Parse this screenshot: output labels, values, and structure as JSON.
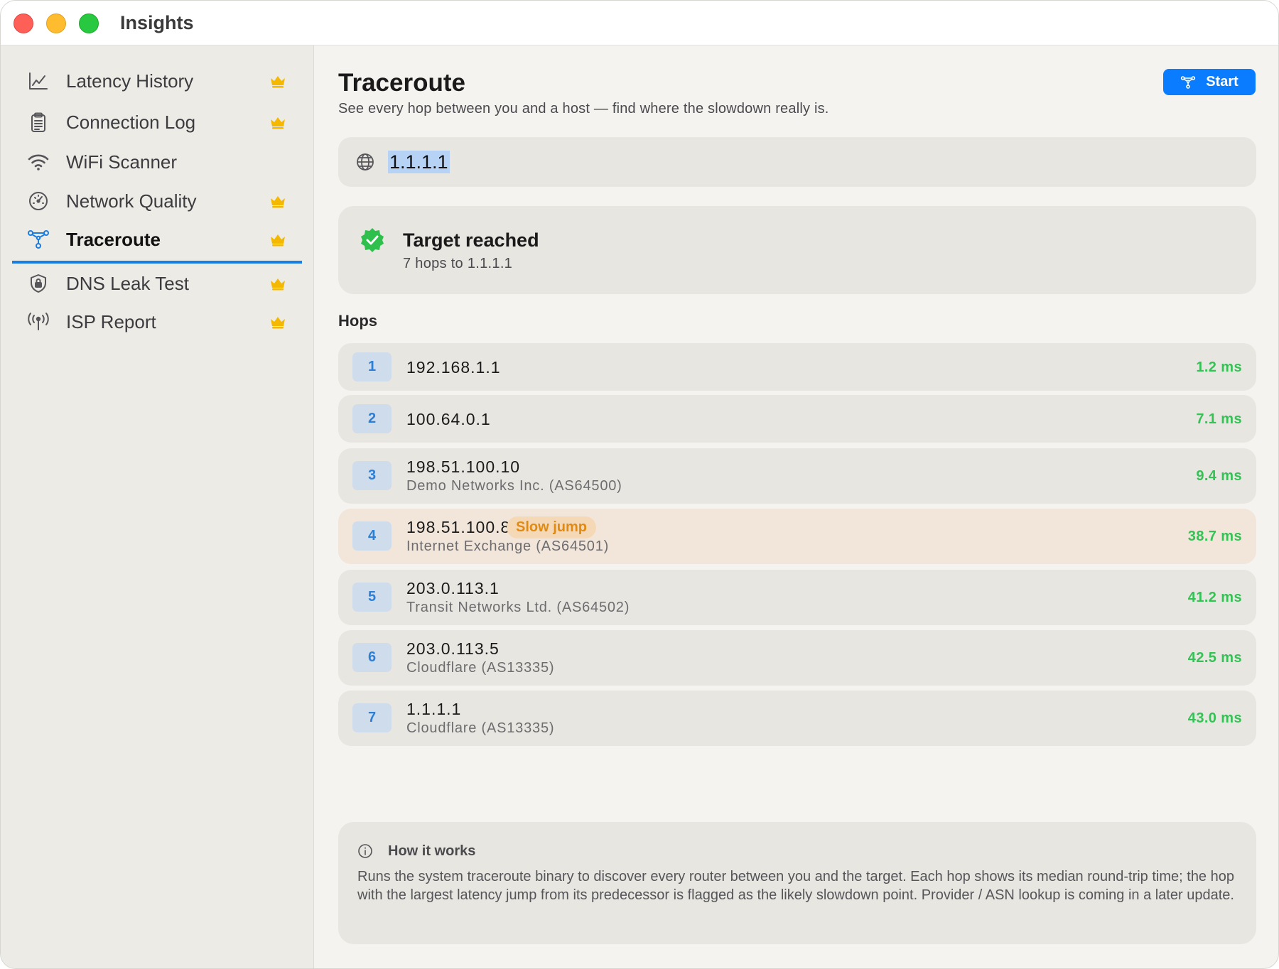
{
  "window": {
    "title": "Insights"
  },
  "sidebar": {
    "items": [
      {
        "label": "Latency History",
        "icon": "chart-line-icon",
        "premium": true
      },
      {
        "label": "Connection Log",
        "icon": "clipboard-icon",
        "premium": true
      },
      {
        "label": "WiFi Scanner",
        "icon": "wifi-icon",
        "premium": false
      },
      {
        "label": "Network Quality",
        "icon": "speedometer-icon",
        "premium": true
      },
      {
        "label": "Traceroute",
        "icon": "network-nodes-icon",
        "premium": true,
        "active": true
      },
      {
        "label": "DNS Leak Test",
        "icon": "shield-icon",
        "premium": true
      },
      {
        "label": "ISP Report",
        "icon": "antenna-icon",
        "premium": true
      }
    ]
  },
  "main": {
    "title": "Traceroute",
    "subtitle": "See every hop between you and a host — find where the slowdown really is.",
    "start_label": "Start",
    "host_input": {
      "value": "1.1.1.1"
    },
    "status": {
      "title": "Target reached",
      "subtitle": "7 hops to 1.1.1.1"
    },
    "hops_header": "Hops",
    "hops": [
      {
        "num": "1",
        "ip": "192.168.1.1",
        "asn": "",
        "ms": "1.2 ms",
        "slow": false
      },
      {
        "num": "2",
        "ip": "100.64.0.1",
        "asn": "",
        "ms": "7.1 ms",
        "slow": false
      },
      {
        "num": "3",
        "ip": "198.51.100.10",
        "asn": "Demo Networks Inc. (AS64500)",
        "ms": "9.4 ms",
        "slow": false
      },
      {
        "num": "4",
        "ip": "198.51.100.84",
        "asn": "Internet Exchange (AS64501)",
        "ms": "38.7 ms",
        "slow": true,
        "slow_label": "Slow jump"
      },
      {
        "num": "5",
        "ip": "203.0.113.1",
        "asn": "Transit Networks Ltd. (AS64502)",
        "ms": "41.2 ms",
        "slow": false
      },
      {
        "num": "6",
        "ip": "203.0.113.5",
        "asn": "Cloudflare (AS13335)",
        "ms": "42.5 ms",
        "slow": false
      },
      {
        "num": "7",
        "ip": "1.1.1.1",
        "asn": "Cloudflare (AS13335)",
        "ms": "43.0 ms",
        "slow": false
      }
    ],
    "info": {
      "title": "How it works",
      "body": "Runs the system traceroute binary to discover every router between you and the target. Each hop shows its median round-trip time; the hop with the largest latency jump from its predecessor is flagged as the likely slowdown point. Provider / ASN lookup is coming in a later update."
    }
  },
  "colors": {
    "accent": "#0a7cff",
    "active_underline": "#1c7de0",
    "latency_good": "#35c155",
    "slow_text": "#e08a12",
    "crown": "#f5b800",
    "success": "#2fbf4d"
  }
}
